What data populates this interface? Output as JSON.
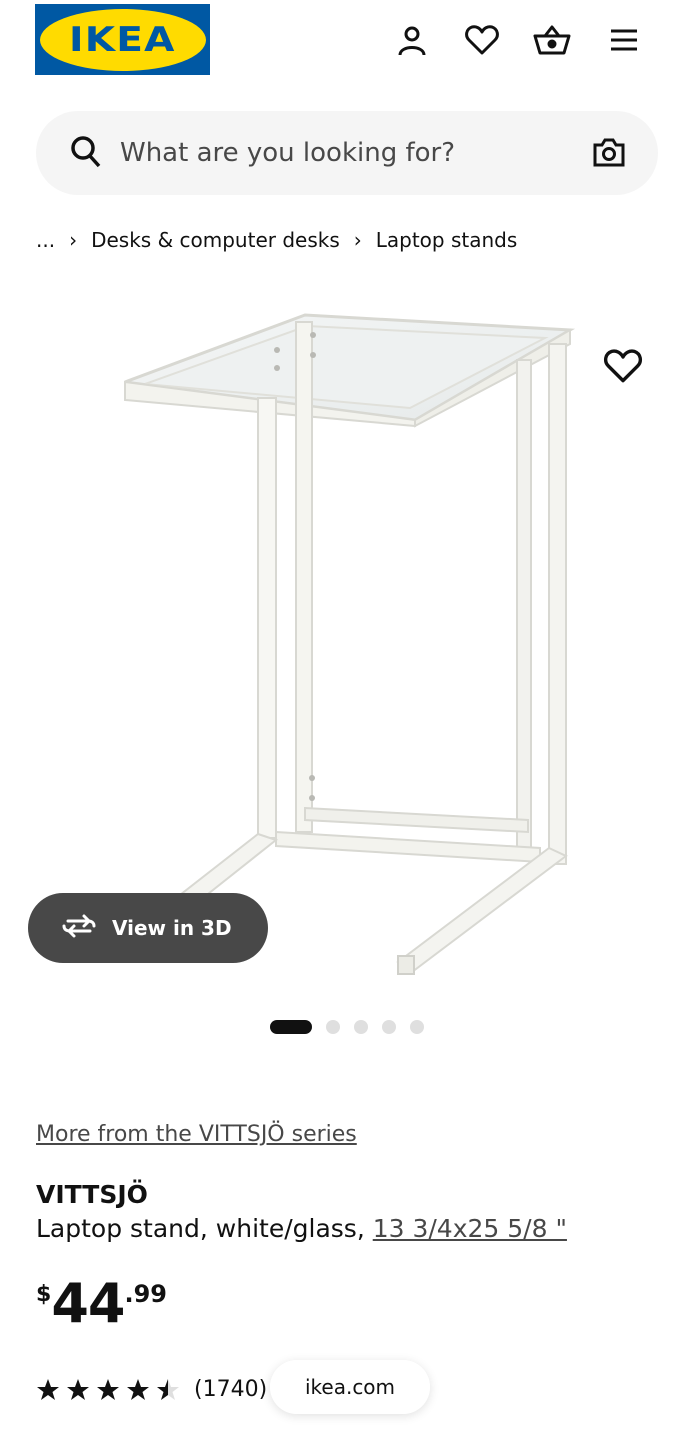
{
  "header": {
    "logo_text": "IKEA",
    "icons": [
      "profile-icon",
      "heart-icon",
      "basket-icon",
      "menu-icon"
    ]
  },
  "search": {
    "placeholder": "What are you looking for?"
  },
  "breadcrumb": {
    "items": [
      "...",
      "Desks & computer desks",
      "Laptop stands"
    ]
  },
  "gallery": {
    "view3d_label": "View in 3D",
    "image_count": 5,
    "active_index": 0
  },
  "product": {
    "series_link": "More from the VITTSJÖ series",
    "name": "VITTSJÖ",
    "description": "Laptop stand, white/glass, ",
    "dimensions": "13 3/4x25 5/8 \"",
    "price_currency": "$",
    "price_integer": "44",
    "price_decimal": ".99",
    "rating": 4.5,
    "rating_count": "(1740)"
  },
  "overlay": {
    "domain_pill": "ikea.com"
  },
  "colors": {
    "ikea_blue": "#0058a3",
    "ikea_yellow": "#ffdb00",
    "pill_dark": "#484848"
  }
}
